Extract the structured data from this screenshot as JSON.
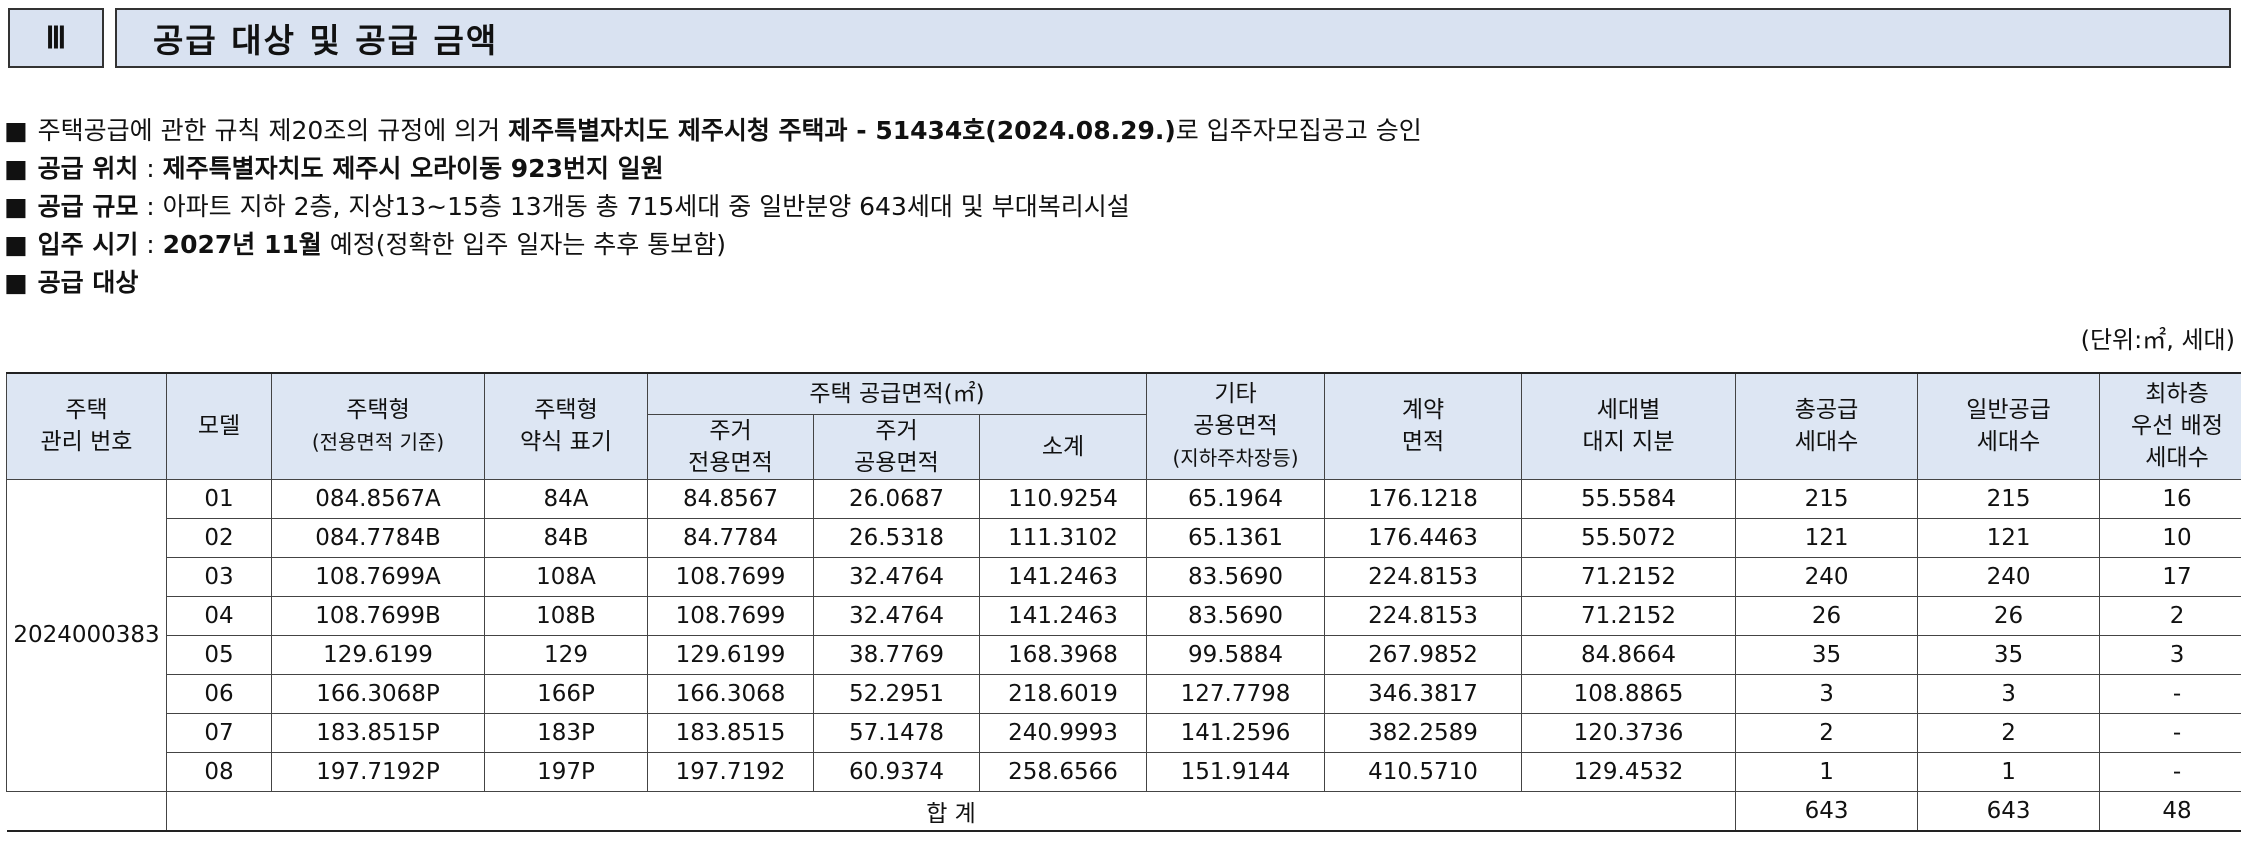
{
  "section": {
    "number": "Ⅲ",
    "title": "공급 대상 및 공급 금액"
  },
  "bullets": {
    "marker": "■",
    "line1": {
      "text_a": "주택공급에 관한 규칙 제20조의 규정에 의거 ",
      "bold": "제주특별자치도 제주시청 주택과 - 51434호(2024.08.29.)",
      "text_b": "로 입주자모집공고 승인"
    },
    "line2": {
      "label": "공급 위치",
      "sep": " : ",
      "value": "제주특별자치도 제주시 오라이동 923번지 일원"
    },
    "line3": {
      "label": "공급 규모",
      "sep": " : ",
      "value": "아파트 지하 2층, 지상13~15층 13개동 총 715세대 중 일반분양 643세대 및 부대복리시설"
    },
    "line4": {
      "label": "입주 시기",
      "sep": " : ",
      "value_bold": "2027년 11월",
      "value_rest": " 예정(정확한 입주 일자는 추후 통보함)"
    },
    "line5": {
      "label": "공급 대상"
    }
  },
  "unit_note": "(단위:㎡, 세대)",
  "table": {
    "headers": {
      "house_no_1": "주택",
      "house_no_2": "관리 번호",
      "model": "모델",
      "type_1": "주택형",
      "type_2": "(전용면적 기준)",
      "abbr_1": "주택형",
      "abbr_2": "약식 표기",
      "supply_area": "주택 공급면적(㎡)",
      "exclusive_1": "주거",
      "exclusive_2": "전용면적",
      "common_1": "주거",
      "common_2": "공용면적",
      "subtotal": "소계",
      "other_1": "기타",
      "other_2": "공용면적",
      "other_3": "(지하주차장등)",
      "contract_1": "계약",
      "contract_2": "면적",
      "land_1": "세대별",
      "land_2": "대지 지분",
      "total_units_1": "총공급",
      "total_units_2": "세대수",
      "general_units_1": "일반공급",
      "general_units_2": "세대수",
      "lowest_1": "최하층",
      "lowest_2": "우선 배정",
      "lowest_3": "세대수"
    },
    "house_no": "2024000383",
    "rows": [
      [
        "01",
        "084.8567A",
        "84A",
        "84.8567",
        "26.0687",
        "110.9254",
        "65.1964",
        "176.1218",
        "55.5584",
        "215",
        "215",
        "16"
      ],
      [
        "02",
        "084.7784B",
        "84B",
        "84.7784",
        "26.5318",
        "111.3102",
        "65.1361",
        "176.4463",
        "55.5072",
        "121",
        "121",
        "10"
      ],
      [
        "03",
        "108.7699A",
        "108A",
        "108.7699",
        "32.4764",
        "141.2463",
        "83.5690",
        "224.8153",
        "71.2152",
        "240",
        "240",
        "17"
      ],
      [
        "04",
        "108.7699B",
        "108B",
        "108.7699",
        "32.4764",
        "141.2463",
        "83.5690",
        "224.8153",
        "71.2152",
        "26",
        "26",
        "2"
      ],
      [
        "05",
        "129.6199",
        "129",
        "129.6199",
        "38.7769",
        "168.3968",
        "99.5884",
        "267.9852",
        "84.8664",
        "35",
        "35",
        "3"
      ],
      [
        "06",
        "166.3068P",
        "166P",
        "166.3068",
        "52.2951",
        "218.6019",
        "127.7798",
        "346.3817",
        "108.8865",
        "3",
        "3",
        "-"
      ],
      [
        "07",
        "183.8515P",
        "183P",
        "183.8515",
        "57.1478",
        "240.9993",
        "141.2596",
        "382.2589",
        "120.3736",
        "2",
        "2",
        "-"
      ],
      [
        "08",
        "197.7192P",
        "197P",
        "197.7192",
        "60.9374",
        "258.6566",
        "151.9144",
        "410.5710",
        "129.4532",
        "1",
        "1",
        "-"
      ]
    ],
    "total": {
      "label": "합 계",
      "total_units": "643",
      "general_units": "643",
      "lowest": "48"
    }
  }
}
